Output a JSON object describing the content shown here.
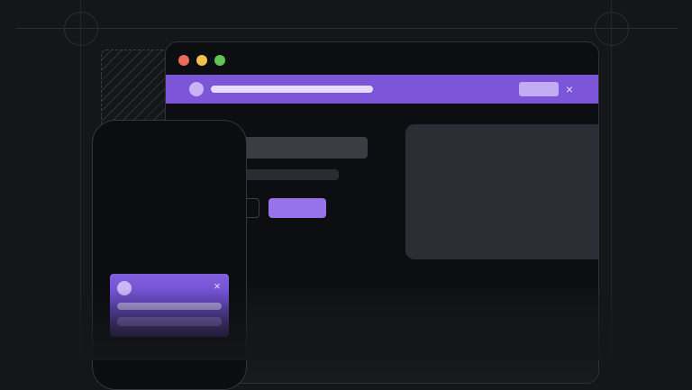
{
  "illustration": {
    "browser": {
      "window_controls": [
        "close",
        "minimize",
        "maximize"
      ],
      "banner": {
        "close_icon": "×",
        "color": "#7c55d9"
      },
      "hero": {
        "primary_color": "#9673e8",
        "card_color": "#2c2e35"
      }
    },
    "phone": {
      "notification": {
        "close_icon": "×",
        "color": "#7c55d9"
      }
    },
    "colors": {
      "background": "#14161a",
      "accent": "#7c55d9",
      "dot_red": "#ed6a5e",
      "dot_yellow": "#f4bf4f",
      "dot_green": "#61c454"
    }
  }
}
